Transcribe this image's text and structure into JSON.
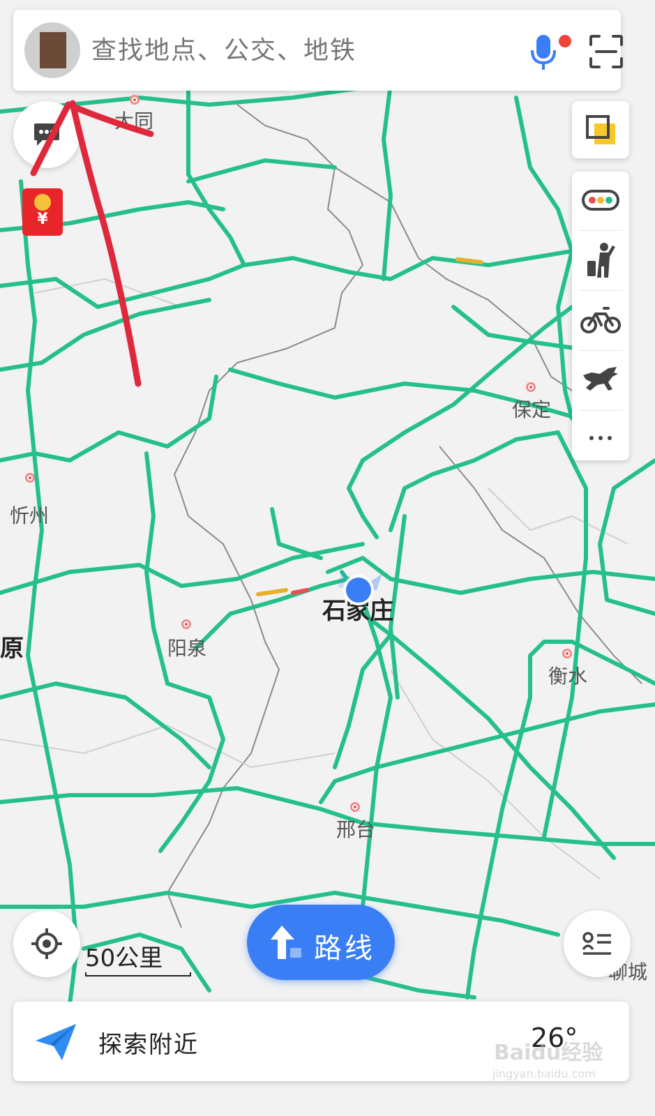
{
  "search": {
    "placeholder": "查找地点、公交、地铁"
  },
  "map": {
    "cities": {
      "datong": "大同",
      "xinzhou": "忻州",
      "taiyuan_partial": "原",
      "yangquan": "阳泉",
      "shijiazhuang": "石家庄",
      "baoding": "保定",
      "hengshui": "衡水",
      "xingtai": "邢台",
      "liaocheng_partial": "聊城"
    },
    "scale_label": "50公里"
  },
  "route_button": {
    "label": "路线"
  },
  "explore": {
    "label": "探索附近",
    "temperature": "26°"
  },
  "watermark": {
    "brand": "Baidu经验",
    "url": "jingyan.baidu.com"
  },
  "colors": {
    "road": "#25c08a",
    "accent": "#3a7ef5",
    "annotation": "#e0283c",
    "redpacket": "#e8262a"
  },
  "icons": {
    "side_tools": [
      "traffic-light-icon",
      "navigation-person-icon",
      "bike-icon",
      "horse-icon",
      "more-icon"
    ],
    "other": [
      "microphone-icon",
      "scan-icon",
      "message-icon",
      "layers-icon",
      "locate-icon",
      "route-arrow-icon",
      "list-icon",
      "paper-plane-icon",
      "red-packet-icon"
    ]
  }
}
